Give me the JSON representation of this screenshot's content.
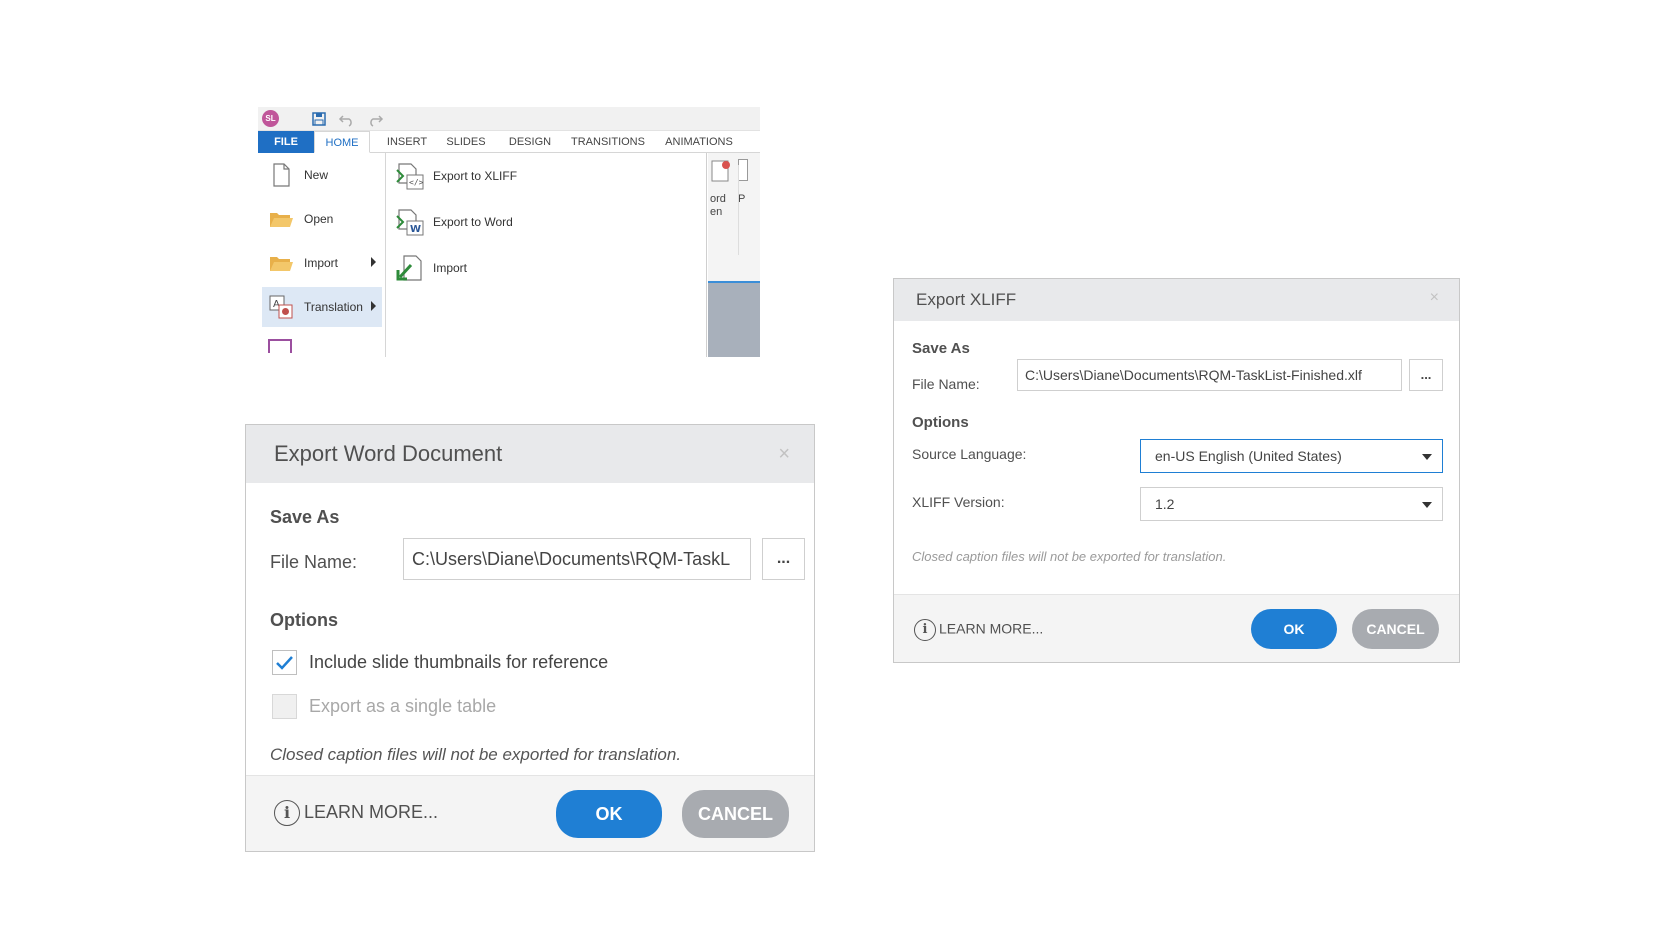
{
  "ribbon": {
    "logo": "SL",
    "tabs": [
      "FILE",
      "HOME",
      "INSERT",
      "SLIDES",
      "DESIGN",
      "TRANSITIONS",
      "ANIMATIONS"
    ],
    "file_menu": [
      {
        "label": "New",
        "icon": "new-document-icon"
      },
      {
        "label": "Open",
        "icon": "folder-icon"
      },
      {
        "label": "Import",
        "icon": "folder-icon",
        "has_submenu": true
      },
      {
        "label": "Translation",
        "icon": "translation-icon",
        "has_submenu": true,
        "active": true
      }
    ],
    "translation_submenu": [
      {
        "label": "Export to XLIFF",
        "icon": "xliff-export-icon"
      },
      {
        "label": "Export to Word",
        "icon": "word-export-icon"
      },
      {
        "label": "Import",
        "icon": "import-arrow-icon"
      }
    ],
    "partial_right_text": [
      "ord",
      "en",
      "P"
    ]
  },
  "word_dialog": {
    "title": "Export Word Document",
    "close_glyph": "×",
    "save_as_heading": "Save As",
    "file_name_label": "File Name:",
    "file_name_value": "C:\\Users\\Diane\\Documents\\RQM-TaskL",
    "browse_label": "...",
    "options_heading": "Options",
    "checkbox_thumbnails": {
      "label": "Include slide thumbnails for reference",
      "checked": true
    },
    "checkbox_single_table": {
      "label": "Export as a single table",
      "checked": false,
      "disabled": true
    },
    "note": "Closed caption files will not be exported for translation.",
    "learn_more": "LEARN MORE...",
    "ok": "OK",
    "cancel": "CANCEL"
  },
  "xliff_dialog": {
    "title": "Export XLIFF",
    "close_glyph": "×",
    "save_as_heading": "Save As",
    "file_name_label": "File Name:",
    "file_name_value": "C:\\Users\\Diane\\Documents\\RQM-TaskList-Finished.xlf",
    "browse_label": "...",
    "options_heading": "Options",
    "source_language_label": "Source Language:",
    "source_language_value": "en-US English (United States)",
    "xliff_version_label": "XLIFF Version:",
    "xliff_version_value": "1.2",
    "note": "Closed caption files will not be exported for translation.",
    "learn_more": "LEARN MORE...",
    "ok": "OK",
    "cancel": "CANCEL"
  },
  "colors": {
    "accent_blue": "#1f7fd4",
    "file_tab_blue": "#1f6fc4",
    "cancel_gray": "#a8abb0",
    "titlebar_gray": "#e8e9eb"
  }
}
